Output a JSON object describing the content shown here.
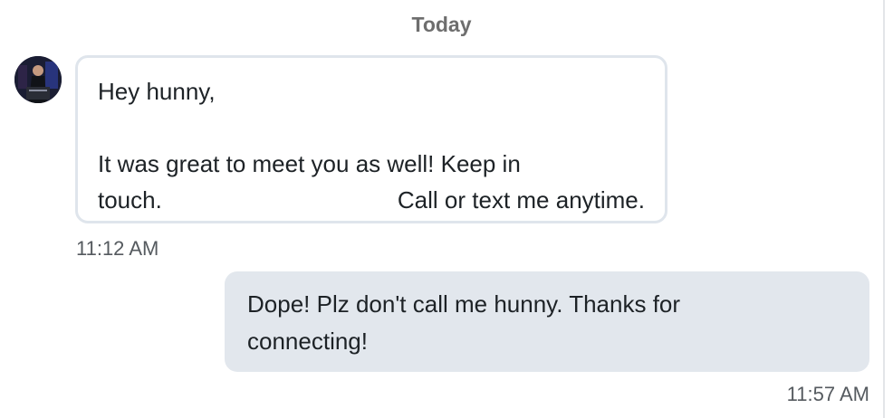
{
  "thread": {
    "date_header": "Today"
  },
  "messages": [
    {
      "direction": "incoming",
      "avatar_icon": "profile-photo-icon",
      "lines": [
        "Hey hunny,",
        "",
        "It was great to meet you as well! Keep in",
        "touch.",
        "Call or text me anytime."
      ],
      "timestamp": "11:12 AM"
    },
    {
      "direction": "outgoing",
      "lines": [
        "Dope! Plz don't call me hunny. Thanks for",
        "connecting!"
      ],
      "timestamp": "11:57 AM"
    }
  ],
  "colors": {
    "incoming_border": "#dfe5ec",
    "outgoing_background": "#e2e7ed",
    "timestamp_text": "#555a5f",
    "date_header_text": "#6e6e6e"
  }
}
